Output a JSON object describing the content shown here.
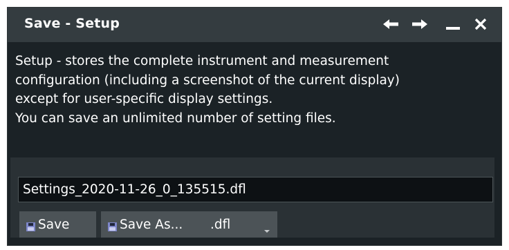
{
  "dialog": {
    "title": "Save - Setup",
    "controls": [
      "back-arrow-icon",
      "forward-arrow-icon",
      "minimize-icon",
      "close-icon"
    ],
    "description": [
      "Setup - stores the complete instrument and measurement",
      "configuration (including a screenshot of the current display)",
      "except for user-specific display settings.",
      "You can save an unlimited number of setting files."
    ],
    "filename": "Settings_2020-11-26_0_135515.dfl",
    "buttons": {
      "save_label": "Save",
      "save_as_label": "Save As...",
      "extension_value": ".dfl"
    }
  },
  "colors": {
    "background": "#1b2226",
    "titlebar": "#343c40",
    "button": "#4c5357",
    "disk_icon": "#7d86c9",
    "text": "#ffffff"
  }
}
